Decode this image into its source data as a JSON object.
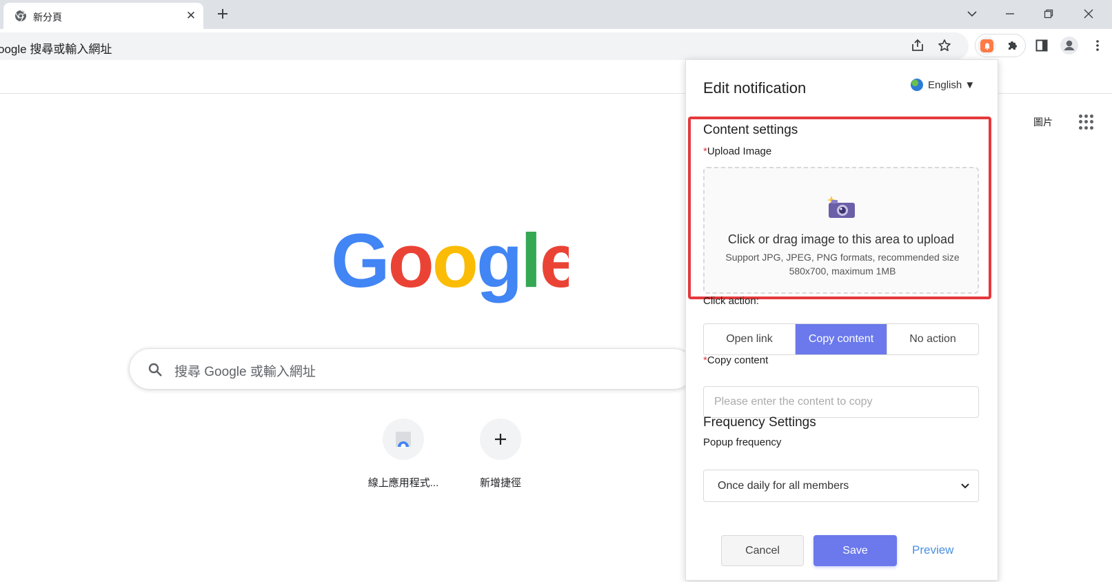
{
  "browser": {
    "tab": {
      "title": "新分頁",
      "favicon": "chrome-icon",
      "close_icon": "close-icon"
    },
    "new_tab_icon": "plus-icon",
    "window_controls": [
      "chevron-down-icon",
      "minimize-icon",
      "restore-icon",
      "close-icon"
    ],
    "omnibox": {
      "text": "oogle 搜尋或輸入網址"
    },
    "toolbar_icons": [
      "share-icon",
      "star-icon",
      "notification-extension-icon",
      "puzzle-icon",
      "side-panel-icon",
      "profile-icon",
      "more-vert-icon"
    ]
  },
  "ntp": {
    "images_link": "圖片",
    "apps_icon": "apps-grid-icon",
    "logo_text": "Google",
    "search": {
      "placeholder": "搜尋 Google 或輸入網址",
      "icon": "search-icon"
    },
    "shortcuts": [
      {
        "label": "線上應用程式...",
        "icon": "webstore-icon"
      },
      {
        "label": "新增捷徑",
        "icon": "plus-icon"
      }
    ]
  },
  "popup": {
    "title": "Edit notification",
    "language": "English ▼",
    "content_settings": {
      "title": "Content settings",
      "upload_label": "Upload Image",
      "required_mark": "*",
      "upload_title": "Click or drag image to this area to upload",
      "upload_hint": "Support JPG, JPEG, PNG formats, recommended size 580x700, maximum 1MB",
      "upload_icon": "camera-icon"
    },
    "click_action": {
      "label": "Click action:",
      "options": [
        "Open link",
        "Copy content",
        "No action"
      ],
      "selected": "Copy content"
    },
    "copy_content": {
      "label": "Copy content",
      "placeholder": "Please enter the content to copy"
    },
    "frequency": {
      "title": "Frequency Settings",
      "label": "Popup frequency",
      "selected": "Once daily for all members"
    },
    "buttons": {
      "cancel": "Cancel",
      "save": "Save",
      "preview": "Preview"
    },
    "colors": {
      "primary": "#6b79ec",
      "highlight": "#e4393c",
      "link": "#4a90e2"
    }
  }
}
